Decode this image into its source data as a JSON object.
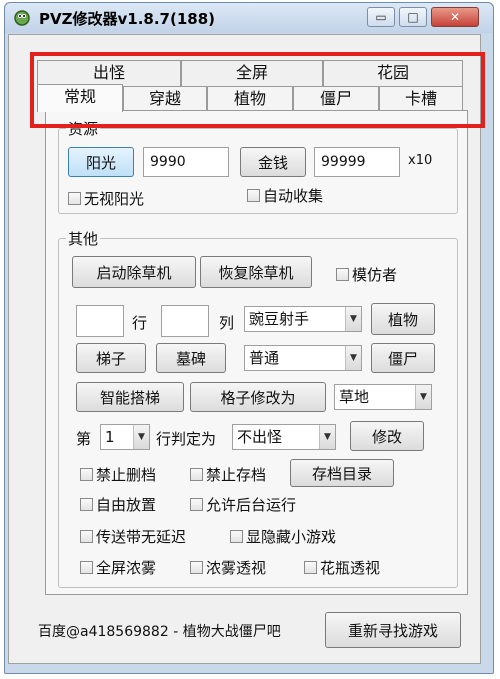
{
  "window": {
    "title": "PVZ修改器v1.8.7(188)",
    "minimize_label": "▭",
    "maximize_label": "□",
    "close_label": "✕"
  },
  "tabs_back": [
    "出怪",
    "全屏",
    "花园"
  ],
  "tabs_front": [
    "常规",
    "穿越",
    "植物",
    "僵尸",
    "卡槽"
  ],
  "active_tab": "常规",
  "resources": {
    "group_label": "资源",
    "sun_button": "阳光",
    "sun_value": "9990",
    "money_button": "金钱",
    "money_value": "99999",
    "money_suffix": "x10",
    "ignore_sun": "无视阳光",
    "auto_collect": "自动收集"
  },
  "other": {
    "group_label": "其他",
    "start_mower": "启动除草机",
    "restore_mower": "恢复除草机",
    "imitator": "模仿者",
    "row_label": "行",
    "col_label": "列",
    "plant_select": "豌豆射手",
    "plant_button": "植物",
    "ladder_button": "梯子",
    "tombstone_button": "墓碑",
    "zombie_select": "普通",
    "zombie_button": "僵尸",
    "smart_ladder": "智能搭梯",
    "grid_modify": "格子修改为",
    "grid_select": "草地",
    "row_prefix": "第",
    "row_select": "1",
    "row_judge": "行判定为",
    "spawn_select": "不出怪",
    "modify_button": "修改",
    "no_delete_save": "禁止删档",
    "no_save": "禁止存档",
    "save_dir": "存档目录",
    "free_place": "自由放置",
    "allow_background": "允许后台运行",
    "belt_no_delay": "传送带无延迟",
    "show_hidden_games": "显隐藏小游戏",
    "full_fog": "全屏浓雾",
    "fog_see_through": "浓雾透视",
    "vase_see_through": "花瓶透视"
  },
  "footer": {
    "credit": "百度@a418569882 - 植物大战僵尸吧",
    "refind_game": "重新寻找游戏"
  },
  "colors": {
    "highlight_border": "#e2201c",
    "title_bar": "#c9d9ea"
  }
}
